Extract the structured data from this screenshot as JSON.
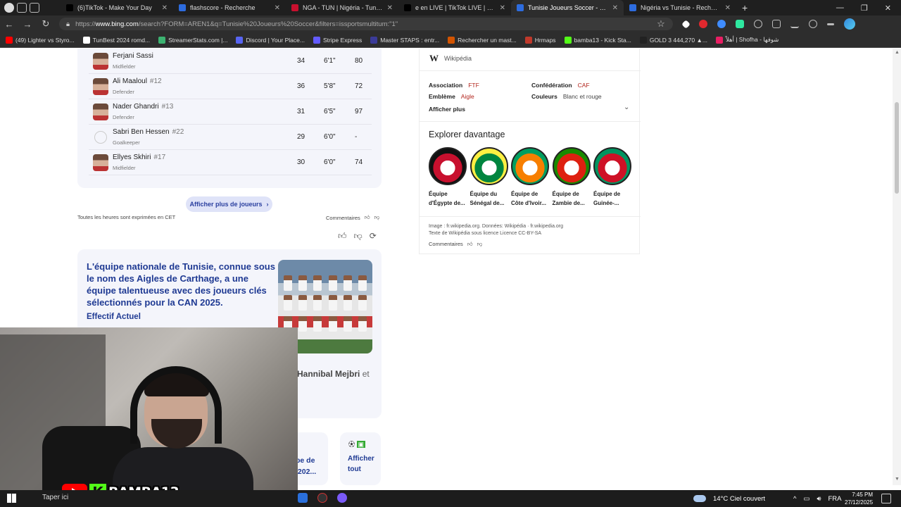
{
  "browser": {
    "tabs": [
      {
        "title": "(6)TikTok - Make Your Day",
        "icon": "tiktok-icon",
        "color": "#000000"
      },
      {
        "title": "flashscore - Recherche",
        "icon": "search-icon",
        "color": "#2d6cdf"
      },
      {
        "title": "NGA - TUN | Nigéria - Tunisie EN",
        "icon": "flashscore-icon",
        "color": "#c8102e"
      },
      {
        "title": "e en LIVE | TikTok LIVE | ظاهر",
        "icon": "tiktok-icon",
        "color": "#000000"
      },
      {
        "title": "Tunisie Joueurs Soccer - Recherc",
        "icon": "search-icon",
        "color": "#2d6cdf",
        "active": true
      },
      {
        "title": "Nigéria vs Tunisie - Recherche",
        "icon": "bing-icon",
        "color": "#2d6cdf"
      }
    ],
    "url_prefix": "https://",
    "url_host": "www.bing.com",
    "url_rest": "/search?FORM=AREN1&q=Tunisie%20Joueurs%20Soccer&filters=issportsmultitum:\"1\"",
    "bookmarks": [
      {
        "label": "(49) Lighter vs Styro...",
        "color": "#ff0000"
      },
      {
        "label": "TunBest 2024 romd...",
        "color": "#ffffff"
      },
      {
        "label": "StreamerStats.com |...",
        "color": "#3cb371"
      },
      {
        "label": "Discord | Your Place...",
        "color": "#5865f2"
      },
      {
        "label": "Stripe Express",
        "color": "#635bff"
      },
      {
        "label": "Master STAPS : entr...",
        "color": "#3b3b98"
      },
      {
        "label": "Rechercher un mast...",
        "color": "#d35400"
      },
      {
        "label": "Hrmaps",
        "color": "#c0392b"
      },
      {
        "label": "bamba13 - Kick Sta...",
        "color": "#53fc18"
      },
      {
        "label": "GOLD 3 444,270 ▲...",
        "color": "#222222"
      },
      {
        "label": "أهلاً | Shofha - شوفها",
        "color": "#e91e63"
      }
    ]
  },
  "players": {
    "rows": [
      {
        "name": "Ferjani Sassi",
        "number": "",
        "position": "Midfielder",
        "age": "34",
        "height": "6'1\"",
        "rating": "80"
      },
      {
        "name": "Ali Maaloul",
        "number": "#12",
        "position": "Defender",
        "age": "36",
        "height": "5'8\"",
        "rating": "72"
      },
      {
        "name": "Nader Ghandri",
        "number": "#13",
        "position": "Defender",
        "age": "31",
        "height": "6'5\"",
        "rating": "97"
      },
      {
        "name": "Sabri Ben Hessen",
        "number": "#22",
        "position": "Goalkeeper",
        "age": "29",
        "height": "6'0\"",
        "rating": "-"
      },
      {
        "name": "Ellyes Skhiri",
        "number": "#17",
        "position": "Midfielder",
        "age": "30",
        "height": "6'0\"",
        "rating": "74"
      }
    ],
    "more_label": "Afficher plus de joueurs",
    "tz_note": "Toutes les heures sont exprimées en CET",
    "comments_label": "Commentaires"
  },
  "summary": {
    "title": "L'équipe nationale de Tunisie, connue sous le nom des Aigles de Carthage, a une équipe talentueuse avec des joueurs clés sélectionnés pour la CAN 2025.",
    "subtitle": "Effectif Actuel",
    "partial_text": "Hannibal Mejbri",
    "partial_suffix": "et"
  },
  "bottom_cards": {
    "card1_line1": "pe de",
    "card1_line2": "/202...",
    "card2_label": "Afficher tout"
  },
  "infobox": {
    "source": "Wikipédia",
    "facts": [
      {
        "label": "Association",
        "value": "FTF",
        "link": true
      },
      {
        "label": "Confédération",
        "value": "CAF",
        "link": true
      },
      {
        "label": "Emblème",
        "value": "Aigle",
        "link": true
      },
      {
        "label": "Couleurs",
        "value": "Blanc et rouge",
        "link": false
      }
    ],
    "show_more": "Afficher plus",
    "explore_title": "Explorer davantage",
    "explore": [
      {
        "label": "Équipe d'Égypte de...",
        "color1": "#c8102e",
        "color2": "#111111"
      },
      {
        "label": "Équipe du Sénégal de...",
        "color1": "#00853f",
        "color2": "#fdef42"
      },
      {
        "label": "Équipe de Côte d'Ivoir...",
        "color1": "#f77f00",
        "color2": "#009e60"
      },
      {
        "label": "Équipe de Zambie de...",
        "color1": "#de2010",
        "color2": "#198a00"
      },
      {
        "label": "Équipe de Guinée-...",
        "color1": "#ce1126",
        "color2": "#009460"
      }
    ],
    "credit_line1": "Image : fr.wikipedia.org. Données: Wikipédia · fr.wikipedia.org",
    "credit_line2": "Texte de Wikipédia sous licence Licence CC-BY-SA",
    "comments_label": "Commentaires"
  },
  "overlay": {
    "channel_name": "BAMBA13",
    "kick_letter": "K"
  },
  "taskbar": {
    "search_hint": "Taper ici",
    "weather": "14°C  Ciel couvert",
    "lang": "FRA",
    "time": "7:45 PM",
    "date": "27/12/2025"
  }
}
